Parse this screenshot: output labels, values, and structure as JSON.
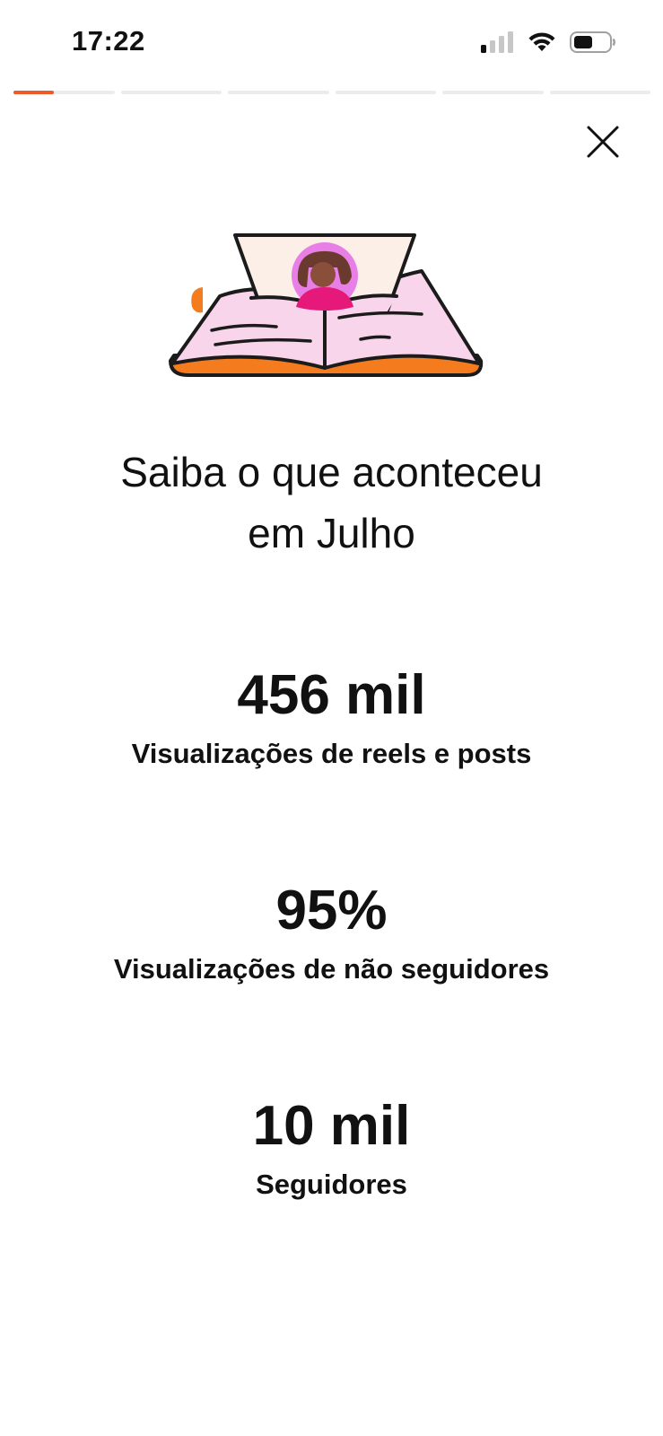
{
  "status_bar": {
    "time": "17:22",
    "icons": [
      "cellular-signal-icon",
      "wifi-icon",
      "battery-icon"
    ]
  },
  "story_progress": {
    "segment_count": 6,
    "active_segment": 0,
    "active_progress": 0.4,
    "active_color": "#f0592a",
    "track_color": "#ececec"
  },
  "close_icon": "close-icon",
  "illustration_icon": "open-book-with-profile-photo-icon",
  "colors": {
    "accent_orange": "#f47c1e",
    "book_pink": "#f8d5ea",
    "avatar_ring": "#e87fe6",
    "avatar_shirt": "#e6197a"
  },
  "header": {
    "title_line1": "Saiba o que aconteceu",
    "title_line2": "em Julho"
  },
  "stats": [
    {
      "value": "456 mil",
      "label": "Visualizações de reels e posts"
    },
    {
      "value": "95%",
      "label": "Visualizações de não seguidores"
    },
    {
      "value": "10 mil",
      "label": "Seguidores"
    }
  ]
}
